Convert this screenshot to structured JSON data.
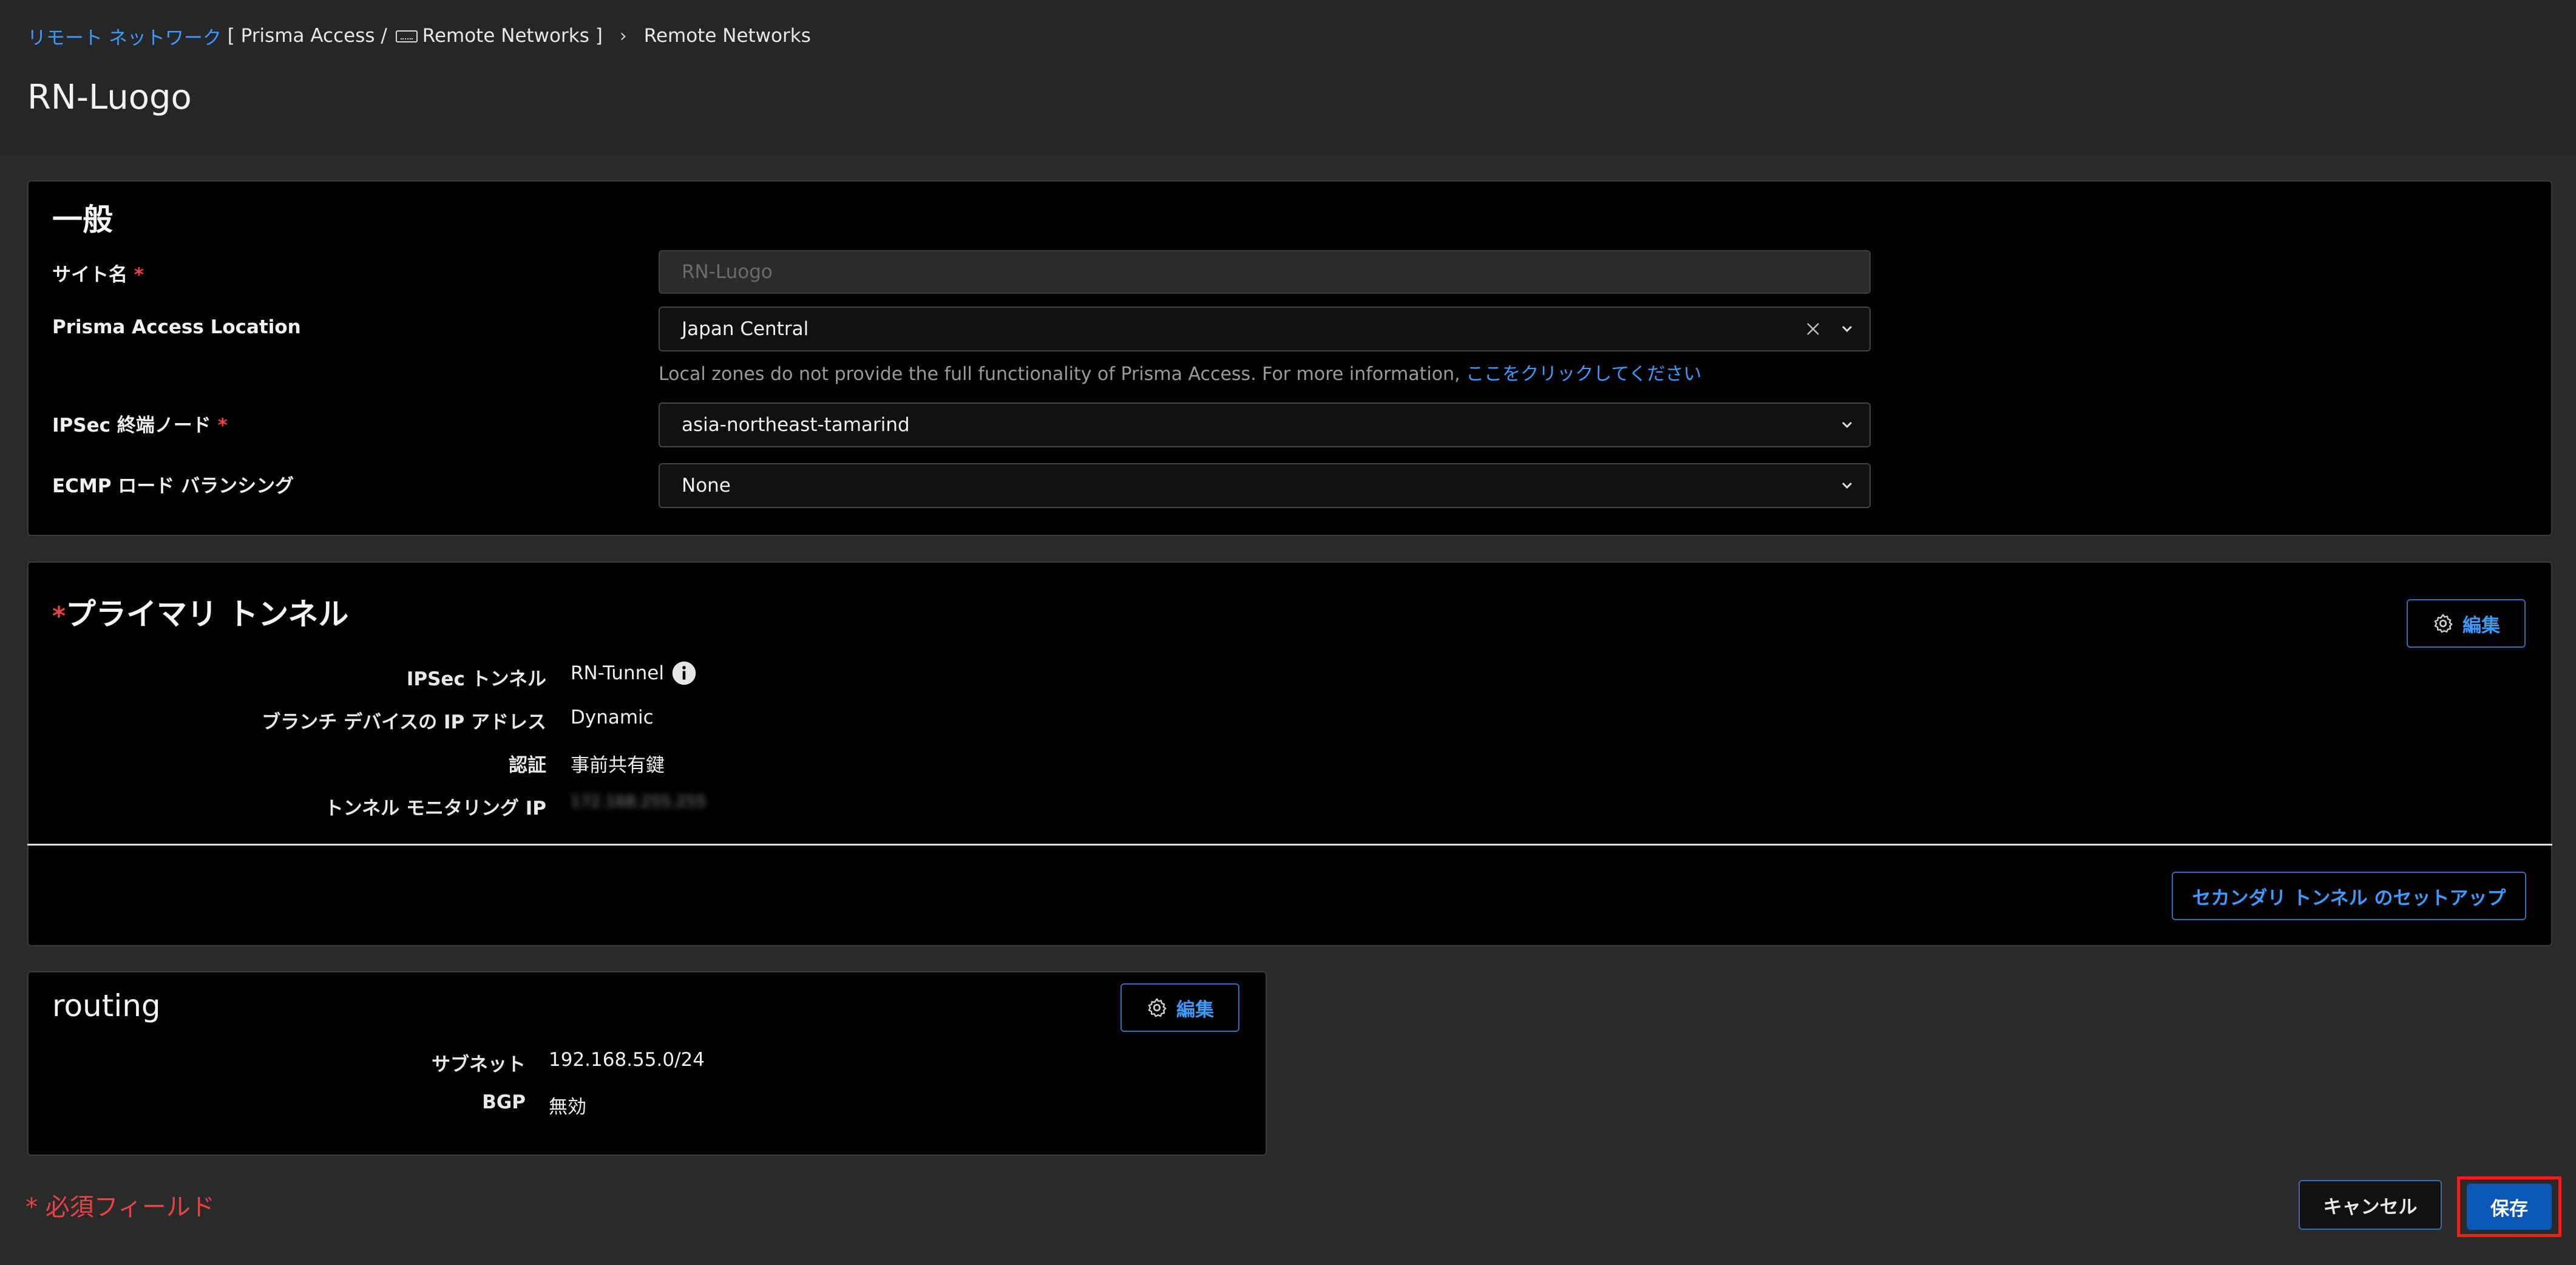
{
  "breadcrumb": {
    "link": "リモート ネットワーク",
    "bracket_prefix": "[ Prisma Access /",
    "bracket_suffix": "Remote Networks ]",
    "current": "Remote Networks"
  },
  "page_title": "RN-Luogo",
  "general": {
    "title": "一般",
    "site_name_label": "サイト名",
    "site_name_placeholder": "RN-Luogo",
    "location_label": "Prisma Access Location",
    "location_value": "Japan Central",
    "helper_text": "Local zones do not provide the full functionality of Prisma Access. For more information,",
    "helper_link": "ここをクリックしてください",
    "ipsec_node_label": "IPSec 終端ノード",
    "ipsec_node_value": "asia-northeast-tamarind",
    "ecmp_label": "ECMP ロード バランシング",
    "ecmp_value": "None",
    "required_mark": "*"
  },
  "primary_tunnel": {
    "title": "プライマリ トンネル",
    "edit_label": "編集",
    "rows": [
      {
        "label": "IPSec トンネル",
        "value": "RN-Tunnel"
      },
      {
        "label": "ブランチ デバイスの IP アドレス",
        "value": "Dynamic"
      },
      {
        "label": "認証",
        "value": "事前共有鍵"
      },
      {
        "label": "トンネル モニタリング IP",
        "value": "172.168.255.255"
      }
    ],
    "secondary_button": "セカンダリ トンネル のセットアップ"
  },
  "routing": {
    "title": "routing",
    "edit_label": "編集",
    "rows": [
      {
        "label": "サブネット",
        "value": "192.168.55.0/24"
      },
      {
        "label": "BGP",
        "value": "無効"
      }
    ]
  },
  "footer": {
    "required_note": "必須フィールド",
    "cancel_label": "キャンセル",
    "save_label": "保存"
  },
  "colors": {
    "accent": "#3d9bff",
    "required": "#e84343",
    "save_bg": "#0a57b8",
    "highlight": "#ff1a1a"
  }
}
